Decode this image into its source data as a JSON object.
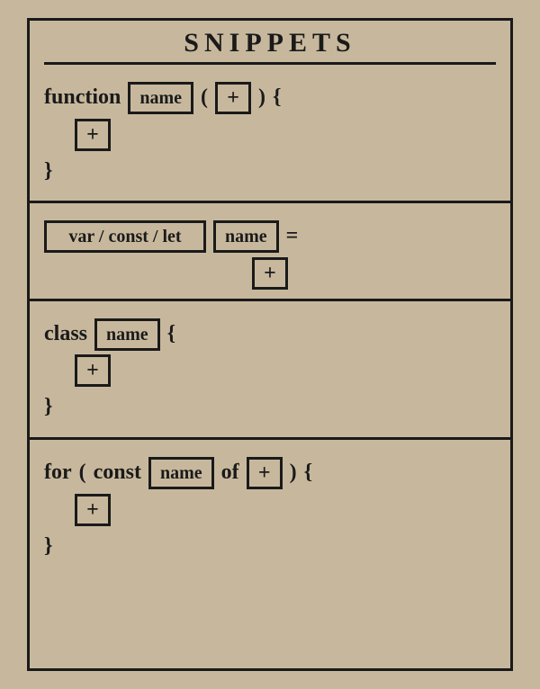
{
  "header": {
    "title": "SNIPPETS"
  },
  "glyphs": {
    "plus": "+"
  },
  "snippets": {
    "function": {
      "keyword": "function",
      "name_placeholder": "name",
      "paren_open": "(",
      "paren_close": ")",
      "brace_open": "{",
      "brace_close": "}"
    },
    "declaration": {
      "kind_options": "var / const / let",
      "name_placeholder": "name",
      "equals": "="
    },
    "class": {
      "keyword": "class",
      "name_placeholder": "name",
      "brace_open": "{",
      "brace_close": "}"
    },
    "for_of": {
      "keyword": "for",
      "paren_open": "(",
      "const_keyword": "const",
      "name_placeholder": "name",
      "of_keyword": "of",
      "paren_close": ")",
      "brace_open": "{",
      "brace_close": "}"
    }
  }
}
